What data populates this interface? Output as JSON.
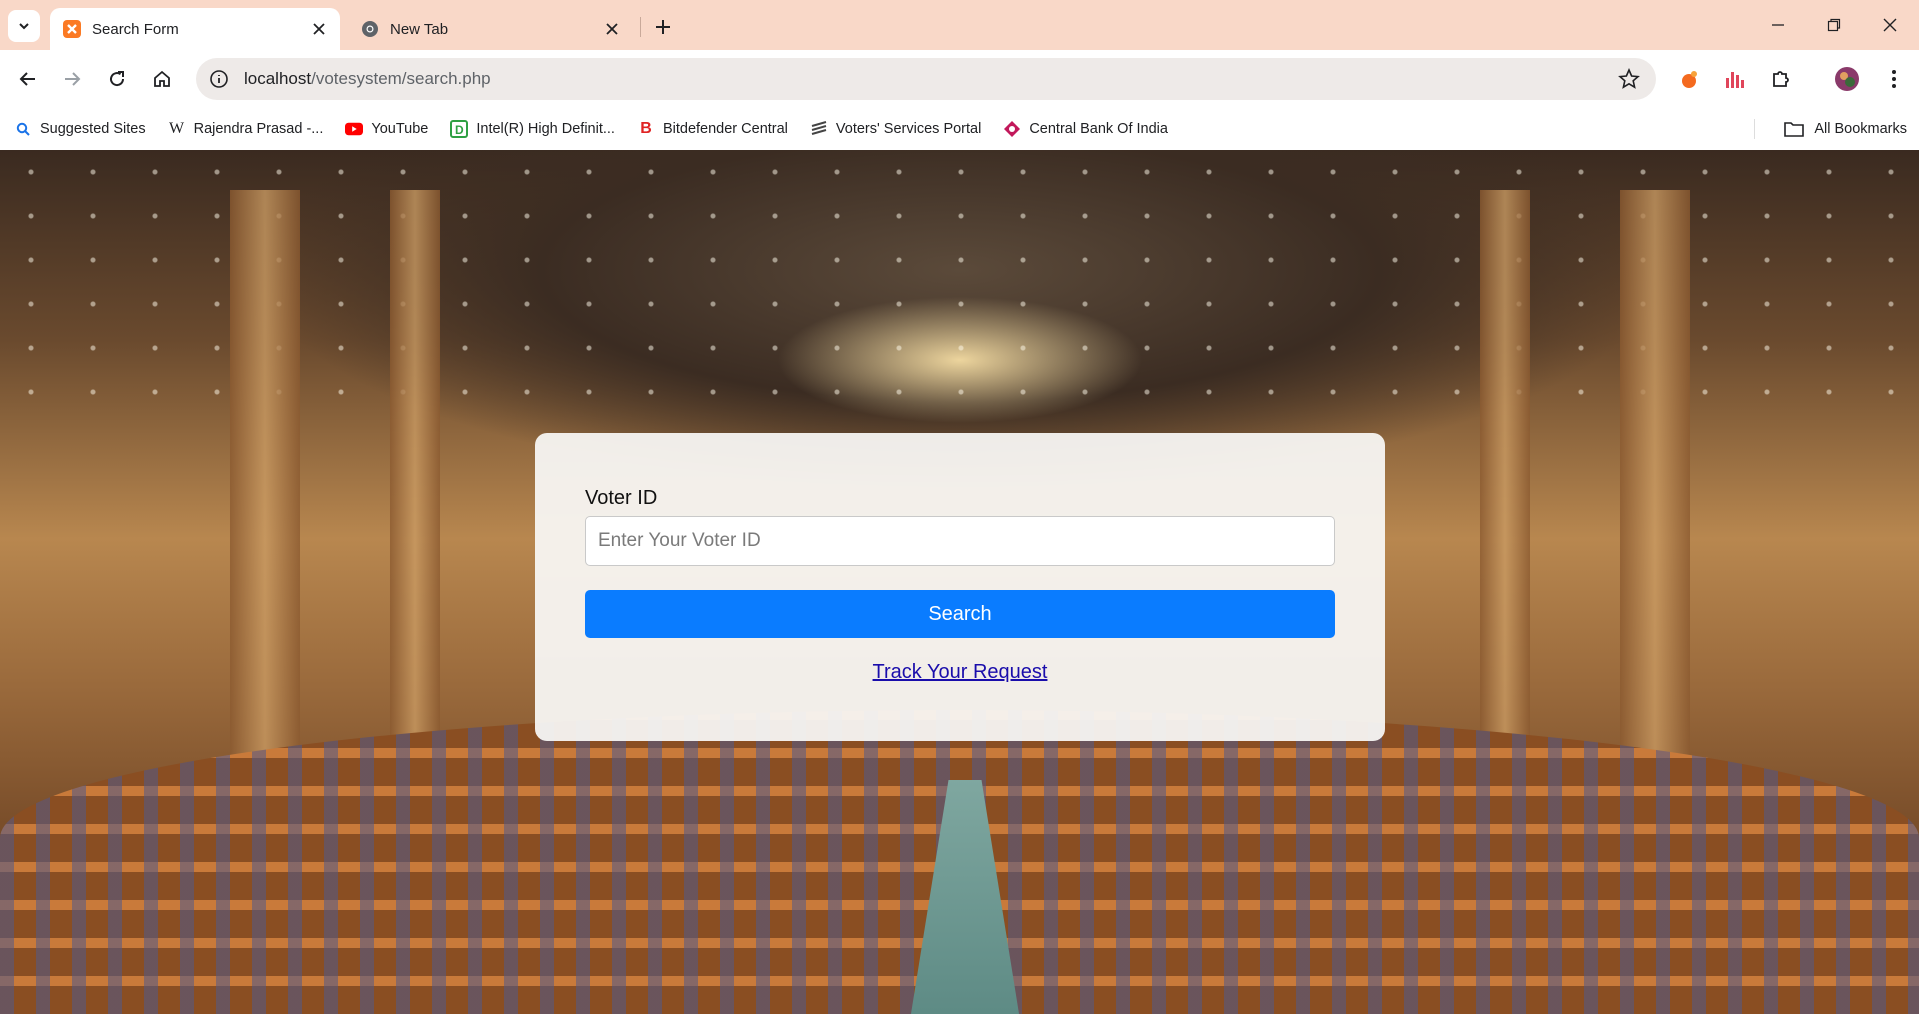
{
  "browser": {
    "tabs": [
      {
        "title": "Search Form",
        "active": true
      },
      {
        "title": "New Tab",
        "active": false
      }
    ],
    "url_host": "localhost",
    "url_path": "/votesystem/search.php",
    "bookmarks": [
      {
        "label": "Suggested Sites",
        "icon": "search-icon"
      },
      {
        "label": "Rajendra Prasad -...",
        "icon": "wikipedia-icon"
      },
      {
        "label": "YouTube",
        "icon": "youtube-icon"
      },
      {
        "label": "Intel(R) High Definit...",
        "icon": "intel-icon"
      },
      {
        "label": "Bitdefender Central",
        "icon": "bitdefender-icon"
      },
      {
        "label": "Voters' Services Portal",
        "icon": "voters-portal-icon"
      },
      {
        "label": "Central Bank Of India",
        "icon": "bank-icon"
      }
    ],
    "all_bookmarks_label": "All Bookmarks"
  },
  "form": {
    "voter_id_label": "Voter ID",
    "voter_id_placeholder": "Enter Your Voter ID",
    "search_label": "Search",
    "track_link": "Track Your Request"
  },
  "colors": {
    "tabstrip": "#f9d8c8",
    "button": "#0a7cff",
    "link": "#1a0dab"
  }
}
